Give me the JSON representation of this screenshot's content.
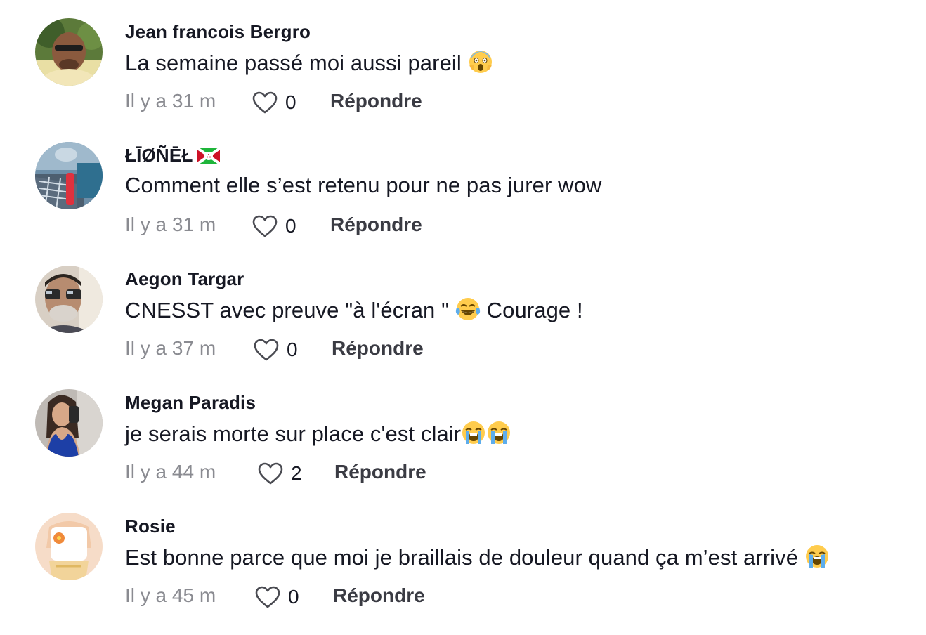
{
  "comments": [
    {
      "username": "Jean francois Bergro",
      "text": "La semaine passé moi aussi pareil",
      "text_emoji": "scream-emoji",
      "time": "Il y a 31 m",
      "likes": "0",
      "reply_label": "Répondre"
    },
    {
      "username": "ŁĪØÑĒŁ",
      "flag": "burundi-flag",
      "text": "Comment elle s’est retenu pour ne pas jurer wow",
      "time": "Il y a 31 m",
      "likes": "0",
      "reply_label": "Répondre"
    },
    {
      "username": "Aegon Targar",
      "text_before": "CNESST avec preuve \"à l'écran \"",
      "text_emoji": "tears-of-joy-emoji",
      "text_after": "Courage !",
      "time": "Il y a 37 m",
      "likes": "0",
      "reply_label": "Répondre"
    },
    {
      "username": "Megan Paradis",
      "text": "je serais morte sur place c'est clair",
      "text_emoji": "loudly-crying-emoji",
      "time": "Il y a 44 m",
      "likes": "2",
      "reply_label": "Répondre"
    },
    {
      "username": "Rosie",
      "text": "Est bonne parce que moi je braillais de douleur quand ça m’est arrivé",
      "text_emoji": "loudly-crying-emoji",
      "time": "Il y a 45 m",
      "likes": "0",
      "reply_label": "Répondre"
    }
  ],
  "colors": {
    "text": "#161823",
    "meta": "#8a8b91",
    "reply": "#3a3b43",
    "background": "#ffffff"
  }
}
